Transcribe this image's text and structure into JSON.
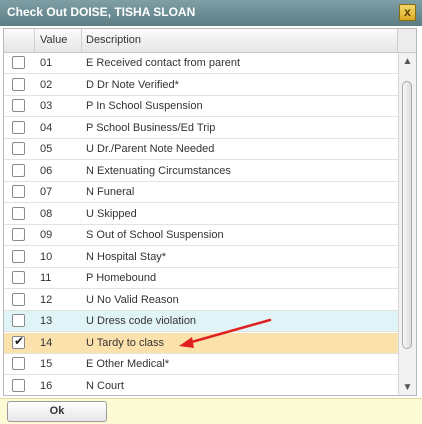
{
  "window": {
    "title": "Check Out DOISE, TISHA SLOAN",
    "close_label": "x"
  },
  "table": {
    "headers": {
      "value": "Value",
      "description": "Description"
    },
    "rows": [
      {
        "value": "01",
        "description": "E Received contact from parent",
        "checked": false,
        "state": ""
      },
      {
        "value": "02",
        "description": "D Dr Note Verified*",
        "checked": false,
        "state": ""
      },
      {
        "value": "03",
        "description": "P In School Suspension",
        "checked": false,
        "state": ""
      },
      {
        "value": "04",
        "description": "P School Business/Ed Trip",
        "checked": false,
        "state": ""
      },
      {
        "value": "05",
        "description": "U Dr./Parent Note Needed",
        "checked": false,
        "state": ""
      },
      {
        "value": "06",
        "description": "N Extenuating Circumstances",
        "checked": false,
        "state": ""
      },
      {
        "value": "07",
        "description": "N Funeral",
        "checked": false,
        "state": ""
      },
      {
        "value": "08",
        "description": "U Skipped",
        "checked": false,
        "state": ""
      },
      {
        "value": "09",
        "description": "S Out of School Suspension",
        "checked": false,
        "state": ""
      },
      {
        "value": "10",
        "description": "N Hospital Stay*",
        "checked": false,
        "state": ""
      },
      {
        "value": "11",
        "description": "P Homebound",
        "checked": false,
        "state": ""
      },
      {
        "value": "12",
        "description": "U No Valid Reason",
        "checked": false,
        "state": ""
      },
      {
        "value": "13",
        "description": "U Dress code violation",
        "checked": false,
        "state": "hover"
      },
      {
        "value": "14",
        "description": "U Tardy to class",
        "checked": true,
        "state": "selected"
      },
      {
        "value": "15",
        "description": "E Other Medical*",
        "checked": false,
        "state": ""
      },
      {
        "value": "16",
        "description": "N Court",
        "checked": false,
        "state": ""
      }
    ]
  },
  "footer": {
    "ok_label": "Ok"
  },
  "colors": {
    "titlebar": "#6e8e96",
    "selected_row": "#fbe2ad",
    "hover_row": "#e0f3f6",
    "annotation_arrow": "#e02020",
    "footer_bg": "#fdfbd6"
  },
  "icons": {
    "close": "close-icon",
    "scroll_up": "chevron-up-icon",
    "scroll_down": "chevron-down-icon",
    "annotation": "red-arrow-icon"
  }
}
